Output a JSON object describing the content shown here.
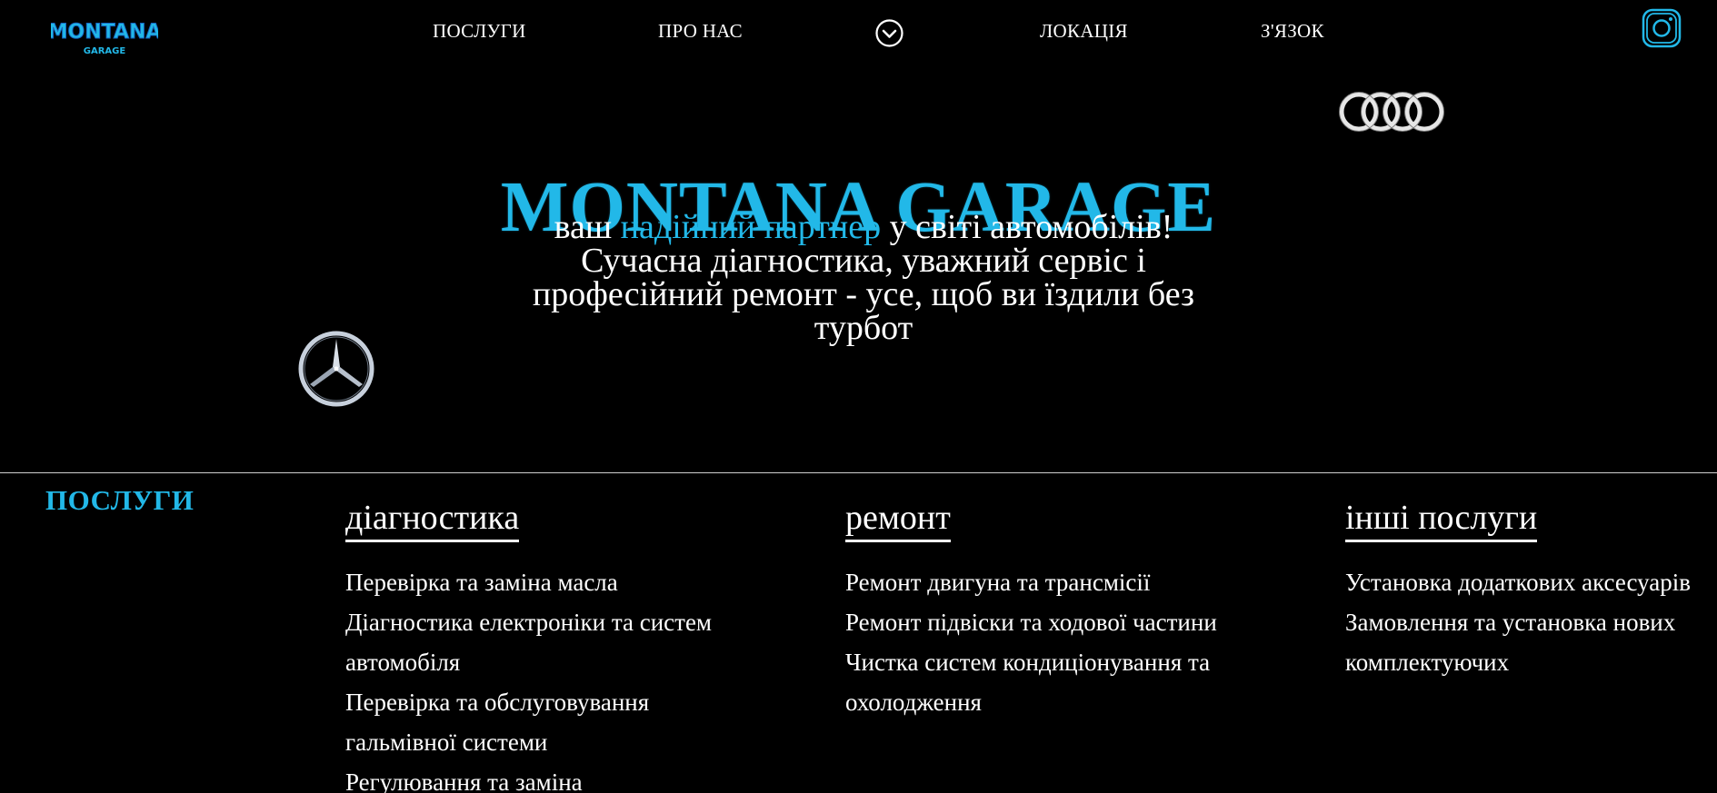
{
  "header": {
    "logo": {
      "text": "MONTANA",
      "subtext": "GARAGE",
      "colors": {
        "primary": "#22b8e8",
        "secondary": "#1565c0"
      }
    },
    "nav": [
      {
        "label": "ПОСЛУГИ"
      },
      {
        "label": "ПРО НАС"
      },
      {
        "label": "ЛОКАЦІЯ"
      },
      {
        "label": "З'ЯЗОК"
      }
    ],
    "toggle_icon": "chevron-down-circle-icon",
    "social_icon": "instagram-icon"
  },
  "hero": {
    "title": "MONTANA GARAGE",
    "subtitle_prefix": "ваш ",
    "subtitle_accent": "надійний партнер",
    "subtitle_rest": " у світі автомобілів! Сучасна діагностика, уважний сервіс і професійний ремонт - усе, щоб ви їздили без турбот",
    "decor_icons": [
      "audi-logo-icon",
      "mercedes-logo-icon"
    ]
  },
  "services": {
    "heading": "ПОСЛУГИ",
    "columns": [
      {
        "title": "діагностика",
        "items": [
          "Перевірка та заміна масла",
          "Діагностика електроніки та систем автомобіля",
          "Перевірка та обслуговування гальмівної системи",
          "Регулювання та заміна"
        ]
      },
      {
        "title": "ремонт",
        "items": [
          "Ремонт двигуна та трансмісії",
          "Ремонт підвіски та ходової частини",
          "Чистка систем кондиціонування та охолодження"
        ]
      },
      {
        "title": "інші послуги",
        "items": [
          "Установка додаткових аксесуарів",
          "Замовлення та установка нових комплектуючих"
        ]
      }
    ]
  },
  "colors": {
    "background": "#000000",
    "accent": "#22b8e8",
    "text": "#ffffff",
    "divider": "#cfcfcf"
  }
}
